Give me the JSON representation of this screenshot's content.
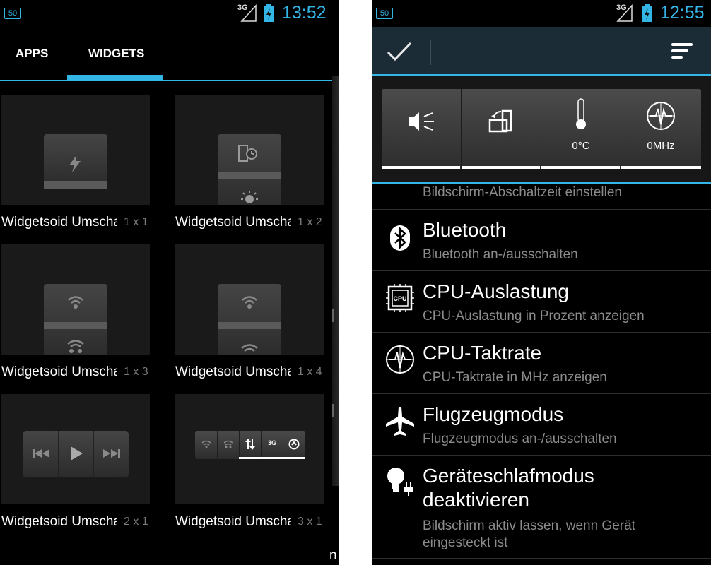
{
  "left": {
    "status": {
      "notif": "50",
      "network": "3G",
      "time": "13:52"
    },
    "tabs": [
      {
        "label": "APPS"
      },
      {
        "label": "WIDGETS"
      }
    ],
    "widgets": [
      {
        "label": "Widgetsoid Umschalter",
        "size": "1 x 1"
      },
      {
        "label": "Widgetsoid Umschalter",
        "size": "1 x 2"
      },
      {
        "label": "Widgetsoid Umschalter",
        "size": "1 x 3"
      },
      {
        "label": "Widgetsoid Umschalter",
        "size": "1 x 4"
      },
      {
        "label": "Widgetsoid Umschalter",
        "size": "2 x 1"
      },
      {
        "label": "Widgetsoid Umschalter",
        "size": "3 x 1"
      }
    ],
    "edge_letter": "n"
  },
  "right": {
    "status": {
      "notif": "50",
      "network": "3G",
      "time": "12:55"
    },
    "quick": {
      "temp": "0°C",
      "freq": "0MHz"
    },
    "partial_item": "Bildschirm-Abschaltzeit einstellen",
    "items": [
      {
        "title": "Bluetooth",
        "subtitle": "Bluetooth an-/ausschalten",
        "icon": "bluetooth-icon"
      },
      {
        "title": "CPU-Auslastung",
        "subtitle": "CPU-Auslastung in Prozent anzeigen",
        "icon": "cpu-icon"
      },
      {
        "title": "CPU-Taktrate",
        "subtitle": "CPU-Taktrate in MHz anzeigen",
        "icon": "cpu-frequency-icon"
      },
      {
        "title": "Flugzeugmodus",
        "subtitle": "Flugzeugmodus an-/ausschalten",
        "icon": "airplane-icon"
      },
      {
        "title": "Geräteschlafmodus deaktivieren",
        "subtitle": "Bildschirm aktiv lassen, wenn Gerät eingesteckt ist",
        "icon": "bulb-plug-icon"
      }
    ],
    "accent": "#33b5e5"
  }
}
